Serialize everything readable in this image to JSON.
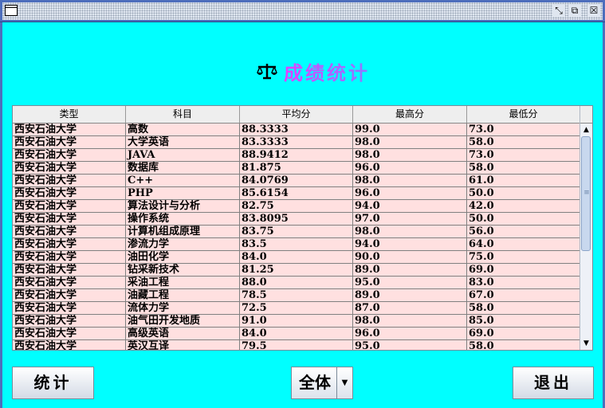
{
  "window": {
    "icons": {
      "app": "window-icon",
      "minimize": "minimize-icon",
      "maximize": "maximize-icon",
      "close": "close-icon"
    }
  },
  "header": {
    "title": "成绩统计",
    "icon": "scale-icon"
  },
  "table": {
    "columns": [
      "类型",
      "科目",
      "平均分",
      "最高分",
      "最低分"
    ],
    "rows": [
      [
        "西安石油大学",
        "高数",
        "88.3333",
        "99.0",
        "73.0"
      ],
      [
        "西安石油大学",
        "大学英语",
        "83.3333",
        "98.0",
        "58.0"
      ],
      [
        "西安石油大学",
        "JAVA",
        "88.9412",
        "98.0",
        "73.0"
      ],
      [
        "西安石油大学",
        "数据库",
        "81.875",
        "96.0",
        "58.0"
      ],
      [
        "西安石油大学",
        "C++",
        "84.0769",
        "98.0",
        "61.0"
      ],
      [
        "西安石油大学",
        "PHP",
        "85.6154",
        "96.0",
        "50.0"
      ],
      [
        "西安石油大学",
        "算法设计与分析",
        "82.75",
        "94.0",
        "42.0"
      ],
      [
        "西安石油大学",
        "操作系统",
        "83.8095",
        "97.0",
        "50.0"
      ],
      [
        "西安石油大学",
        "计算机组成原理",
        "83.75",
        "98.0",
        "56.0"
      ],
      [
        "西安石油大学",
        "渗流力学",
        "83.5",
        "94.0",
        "64.0"
      ],
      [
        "西安石油大学",
        "油田化学",
        "84.0",
        "90.0",
        "75.0"
      ],
      [
        "西安石油大学",
        "钻采新技术",
        "81.25",
        "89.0",
        "69.0"
      ],
      [
        "西安石油大学",
        "采油工程",
        "88.0",
        "95.0",
        "83.0"
      ],
      [
        "西安石油大学",
        "油藏工程",
        "78.5",
        "89.0",
        "67.0"
      ],
      [
        "西安石油大学",
        "流体力学",
        "72.5",
        "87.0",
        "58.0"
      ],
      [
        "西安石油大学",
        "油气田开发地质",
        "91.0",
        "98.0",
        "85.0"
      ],
      [
        "西安石油大学",
        "高级英语",
        "84.0",
        "96.0",
        "69.0"
      ],
      [
        "西安石油大学",
        "英汉互译",
        "79.5",
        "95.0",
        "58.0"
      ]
    ]
  },
  "buttons": {
    "stats": "统计",
    "exit": "退出"
  },
  "filter": {
    "selected": "全体"
  },
  "colors": {
    "background": "#00ffff",
    "row": "#ffe0e0",
    "title_gradient_start": "#e040ff",
    "title_gradient_end": "#8c7bff"
  }
}
